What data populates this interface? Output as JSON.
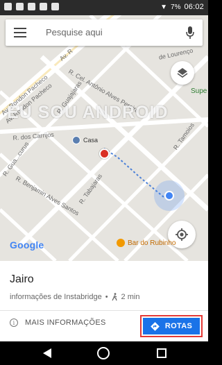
{
  "status_bar": {
    "battery": "7%",
    "time": "06:02"
  },
  "search": {
    "placeholder": "Pesquise aqui"
  },
  "map": {
    "streets": [
      "Av. Rondon Pacheco",
      "Av. Rondon Pacheco",
      "Av. R",
      "R. Cel. Antônio Alves Pereira",
      "R. Guajajaras",
      "R. dos Carrijos",
      "R. Benjamin Alves Santos",
      "R. Tabajaras",
      "R. Tamoios",
      "R. Gua...curus",
      "de Lourenço"
    ],
    "watermark": "EU SOU ANDROID",
    "poi_home": "Casa",
    "poi_bar": "Bar do Rubinho",
    "poi_super": "Supe",
    "logo": "Google"
  },
  "place": {
    "name": "Jairo",
    "subtitle": "informações de Instabridge",
    "separator": "•",
    "walk_time": "2 min"
  },
  "actions": {
    "more_info": "MAIS INFORMAÇÕES",
    "routes": "ROTAS"
  },
  "colors": {
    "accent_blue": "#1a73e8",
    "highlight_red": "#e53935",
    "destination_red": "#d93025"
  },
  "icons": [
    "menu-icon",
    "mic-icon",
    "layers-icon",
    "my-location-icon",
    "info-icon",
    "walk-icon",
    "directions-icon",
    "home-icon",
    "back-icon",
    "recents-icon"
  ]
}
